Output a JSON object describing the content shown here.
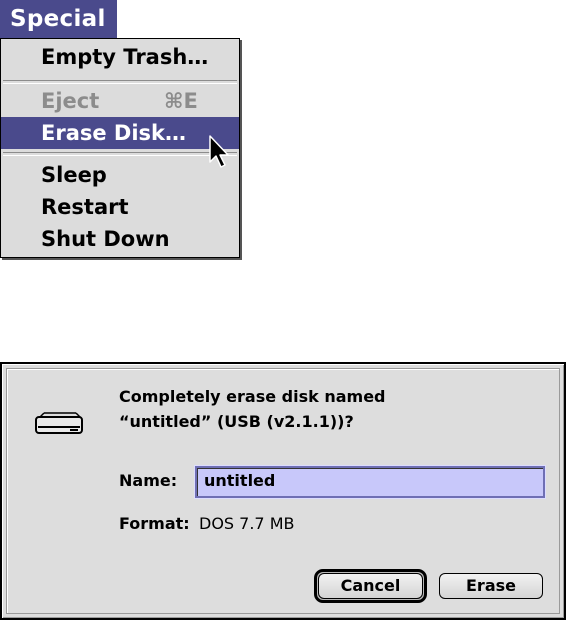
{
  "menu": {
    "title": "Special",
    "items": [
      {
        "label": "Empty Trash…",
        "state": "enabled"
      },
      {
        "label": "Eject",
        "shortcut": "⌘E",
        "state": "disabled"
      },
      {
        "label": "Erase Disk…",
        "state": "highlighted"
      },
      {
        "label": "Sleep",
        "state": "enabled"
      },
      {
        "label": "Restart",
        "state": "enabled"
      },
      {
        "label": "Shut Down",
        "state": "enabled"
      }
    ]
  },
  "dialog": {
    "message_line1": "Completely erase disk named",
    "message_line2": "“untitled” (USB (v2.1.1))?",
    "name_label": "Name:",
    "name_value": "untitled",
    "format_label": "Format:",
    "format_value": "DOS 7.7 MB",
    "cancel_label": "Cancel",
    "erase_label": "Erase",
    "default_button": "cancel"
  },
  "colors": {
    "menu_highlight": "#4a4a8c",
    "menu_background": "#dcdcdc",
    "disabled_text": "#8c8c8c",
    "dialog_background": "#dddddd",
    "field_selection": "#c8c8fa"
  }
}
